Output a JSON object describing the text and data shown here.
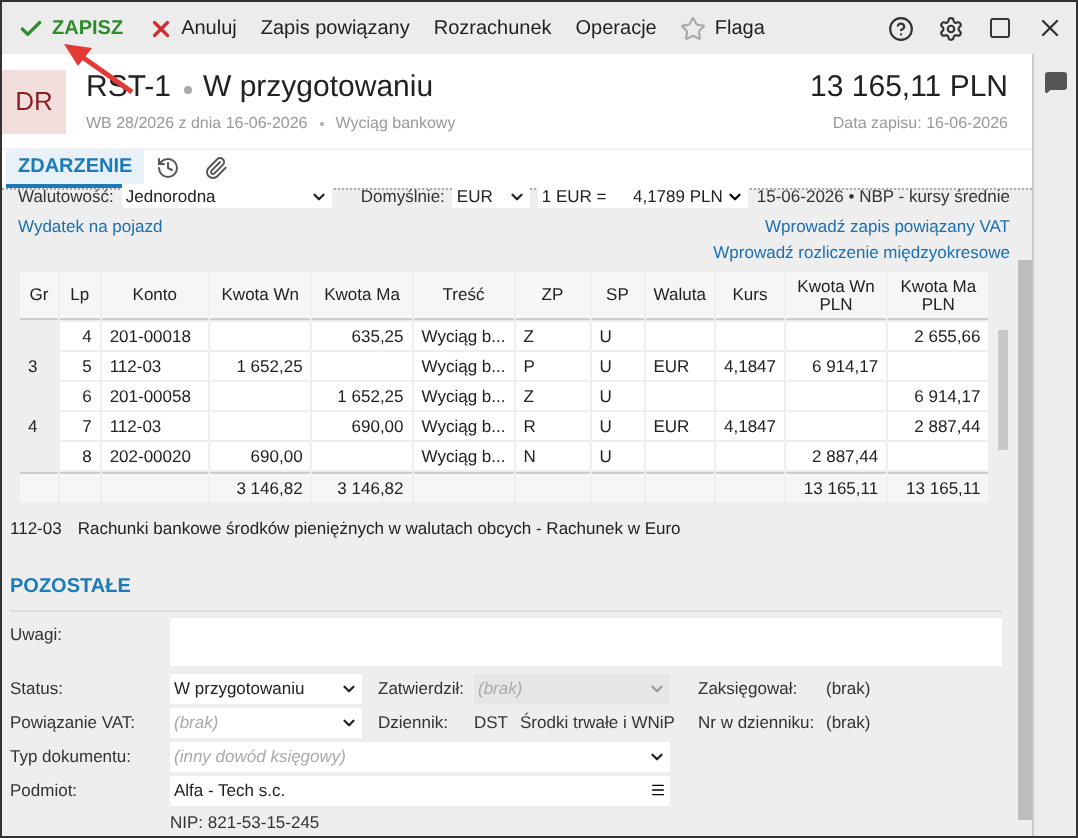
{
  "toolbar": {
    "items": [
      {
        "kind": "save",
        "label": "ZAPISZ"
      },
      {
        "kind": "cancel",
        "label": "Anuluj"
      },
      {
        "kind": "plain",
        "label": "Zapis powiązany"
      },
      {
        "kind": "plain",
        "label": "Rozrachunek"
      },
      {
        "kind": "plain",
        "label": "Operacje"
      },
      {
        "kind": "flag",
        "label": "Flaga"
      }
    ]
  },
  "header": {
    "badge": "DR",
    "number": "RST-1",
    "status": "W przygotowaniu",
    "document": "WB 28/2026 z dnia 16-06-2026",
    "document_type": "Wyciąg bankowy",
    "amount": "13 165,11 PLN",
    "date": "Data zapisu: 16-06-2026"
  },
  "tabs": [
    {
      "kind": "text",
      "label": "ZDARZENIE",
      "selected": true
    },
    {
      "kind": "history",
      "selected": false
    },
    {
      "kind": "attachment",
      "selected": false
    }
  ],
  "currency": {
    "label": "Walutowość:",
    "value": "Jednorodna",
    "default_label": "Domyślnie:",
    "default_value": "EUR",
    "rate_label": "1 EUR =",
    "rate_value": "4,1789 PLN",
    "rate_source": "15-06-2026 • NBP - kursy średnie"
  },
  "links_left": [
    "Wydatek na pojazd"
  ],
  "links_right": [
    "Wprowadź zapis powiązany VAT",
    "Wprowadź rozliczenie międzyokresowe"
  ],
  "table": {
    "columns": [
      "Gr",
      "Lp",
      "Konto",
      "Kwota Wn",
      "Kwota Ma",
      "Treść",
      "ZP",
      "SP",
      "Waluta",
      "Kurs",
      "Kwota Wn PLN",
      "Kwota Ma PLN"
    ],
    "rows": [
      [
        null,
        "4",
        "201-00018",
        null,
        "635,25",
        "Wyciąg b...",
        "Z",
        "U",
        null,
        null,
        null,
        "2 655,66"
      ],
      [
        "3",
        "5",
        "112-03",
        "1 652,25",
        null,
        "Wyciąg b...",
        "P",
        "U",
        "EUR",
        "4,1847",
        "6 914,17",
        null
      ],
      [
        null,
        "6",
        "201-00058",
        null,
        "1 652,25",
        "Wyciąg b...",
        "Z",
        "U",
        null,
        null,
        null,
        "6 914,17"
      ],
      [
        "4",
        "7",
        "112-03",
        null,
        "690,00",
        "Wyciąg b...",
        "R",
        "U",
        "EUR",
        "4,1847",
        null,
        "2 887,44"
      ],
      [
        null,
        "8",
        "202-00020",
        "690,00",
        null,
        "Wyciąg b...",
        "N",
        "U",
        null,
        null,
        "2 887,44",
        null
      ]
    ],
    "totals": {
      "kwota_wn": "3 146,82",
      "kwota_ma": "3 146,82",
      "kwota_wn_pln": "13 165,11",
      "kwota_ma_pln": "13 165,11"
    }
  },
  "account_info": {
    "code": "112-03",
    "description": "Rachunki bankowe środków pieniężnych w walutach obcych - Rachunek w Euro"
  },
  "other": {
    "title": "POZOSTAŁE",
    "notes_label": "Uwagi:",
    "status_label": "Status:",
    "status_value": "W przygotowaniu",
    "approved_label": "Zatwierdził:",
    "approved_placeholder": "(brak)",
    "posted_label": "Zaksięgował:",
    "posted_value": "(brak)",
    "vat_label": "Powiązanie VAT:",
    "vat_placeholder": "(brak)",
    "journal_label": "Dziennik:",
    "journal_code": "DST",
    "journal_name": "Środki trwałe i WNiP",
    "journal_no_label": "Nr w dzienniku:",
    "journal_no_value": "(brak)",
    "doc_type_label": "Typ dokumentu:",
    "doc_type_placeholder": "(inny dowód księgowy)",
    "entity_label": "Podmiot:",
    "entity_value": "Alfa - Tech s.c.",
    "nip": "NIP:  821-53-15-245"
  }
}
